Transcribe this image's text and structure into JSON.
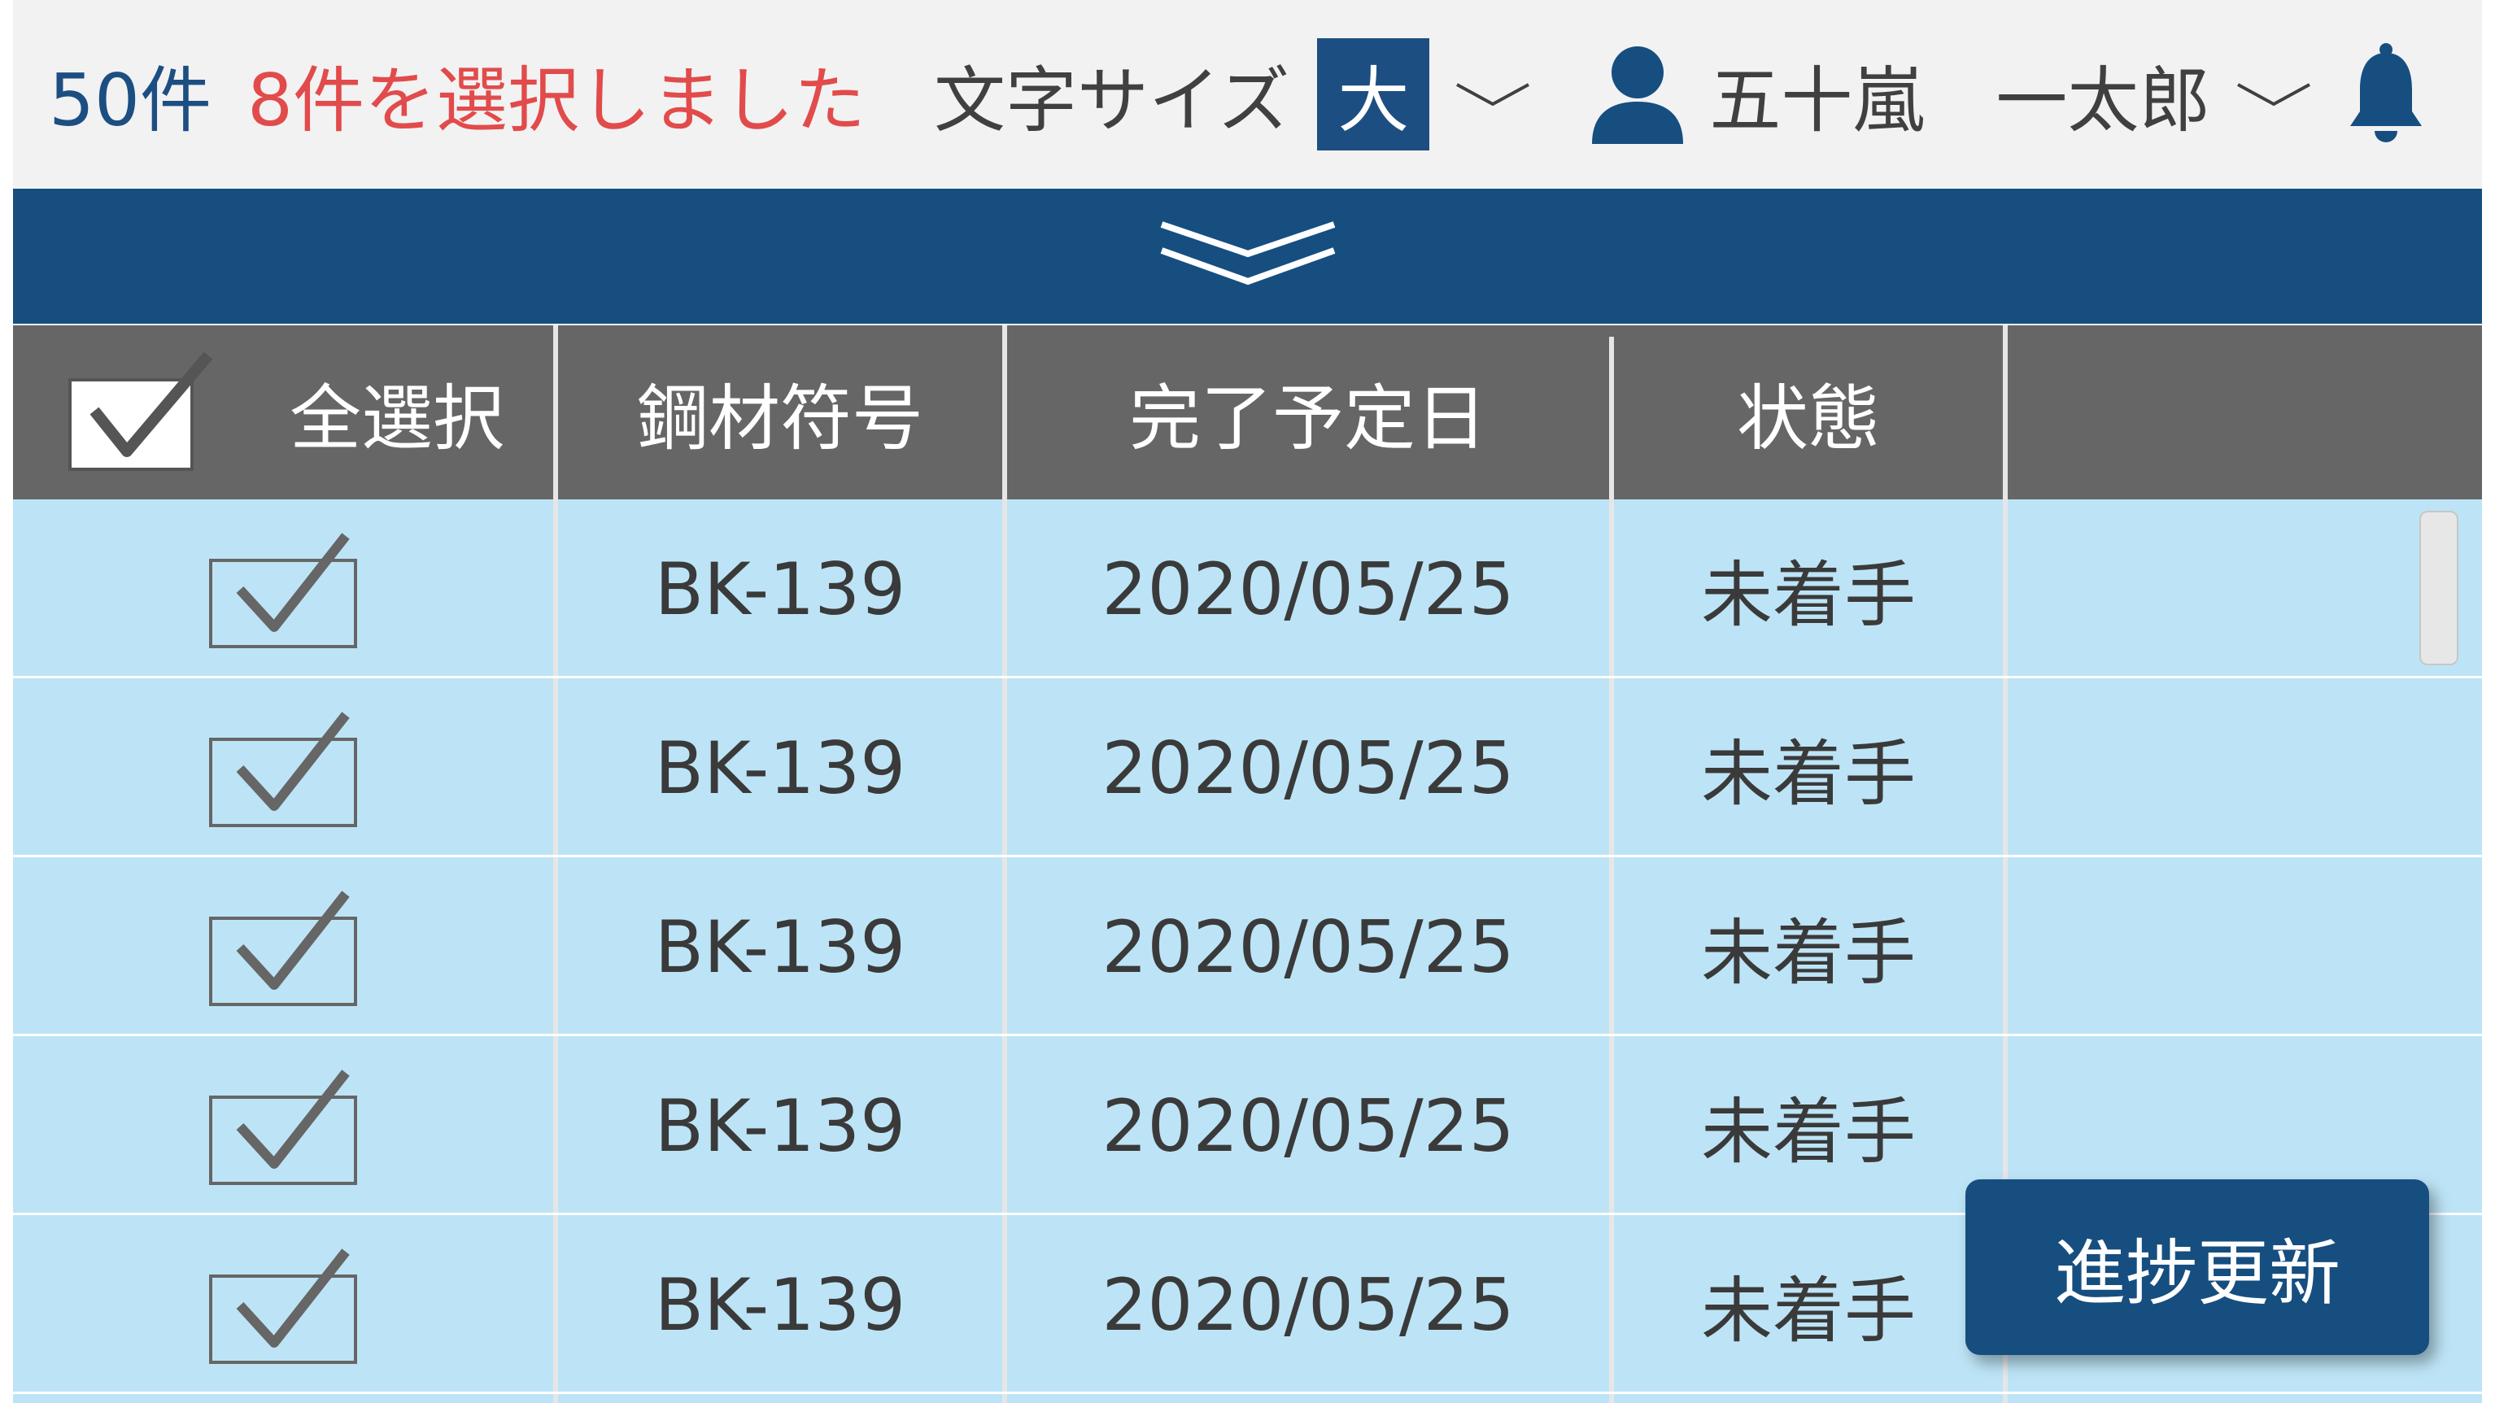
{
  "header": {
    "count": "50件",
    "selected_message": "8件を選択しました",
    "font_size_label": "文字サイズ",
    "font_size_value": "大",
    "user_name": "五十嵐　一太郎"
  },
  "table": {
    "columns": [
      "全選択",
      "鋼材符号",
      "完了予定日",
      "状態"
    ],
    "rows": [
      {
        "checked": true,
        "code": "BK-139",
        "date": "2020/05/25",
        "status": "未着手"
      },
      {
        "checked": true,
        "code": "BK-139",
        "date": "2020/05/25",
        "status": "未着手"
      },
      {
        "checked": true,
        "code": "BK-139",
        "date": "2020/05/25",
        "status": "未着手"
      },
      {
        "checked": true,
        "code": "BK-139",
        "date": "2020/05/25",
        "status": "未着手"
      },
      {
        "checked": true,
        "code": "BK-139",
        "date": "2020/05/25",
        "status": "未着手"
      }
    ]
  },
  "buttons": {
    "progress_update": "進捗更新"
  },
  "icons": {
    "user": "user-icon",
    "bell": "bell-icon",
    "collapse": "double-chevron-down-icon",
    "dropdown": "chevron-down-icon"
  },
  "colors": {
    "primary": "#164e80",
    "count_text": "#1d4e82",
    "selected_text": "#e24b4b",
    "header_row": "#666666",
    "row_bg": "#bde4f6"
  }
}
